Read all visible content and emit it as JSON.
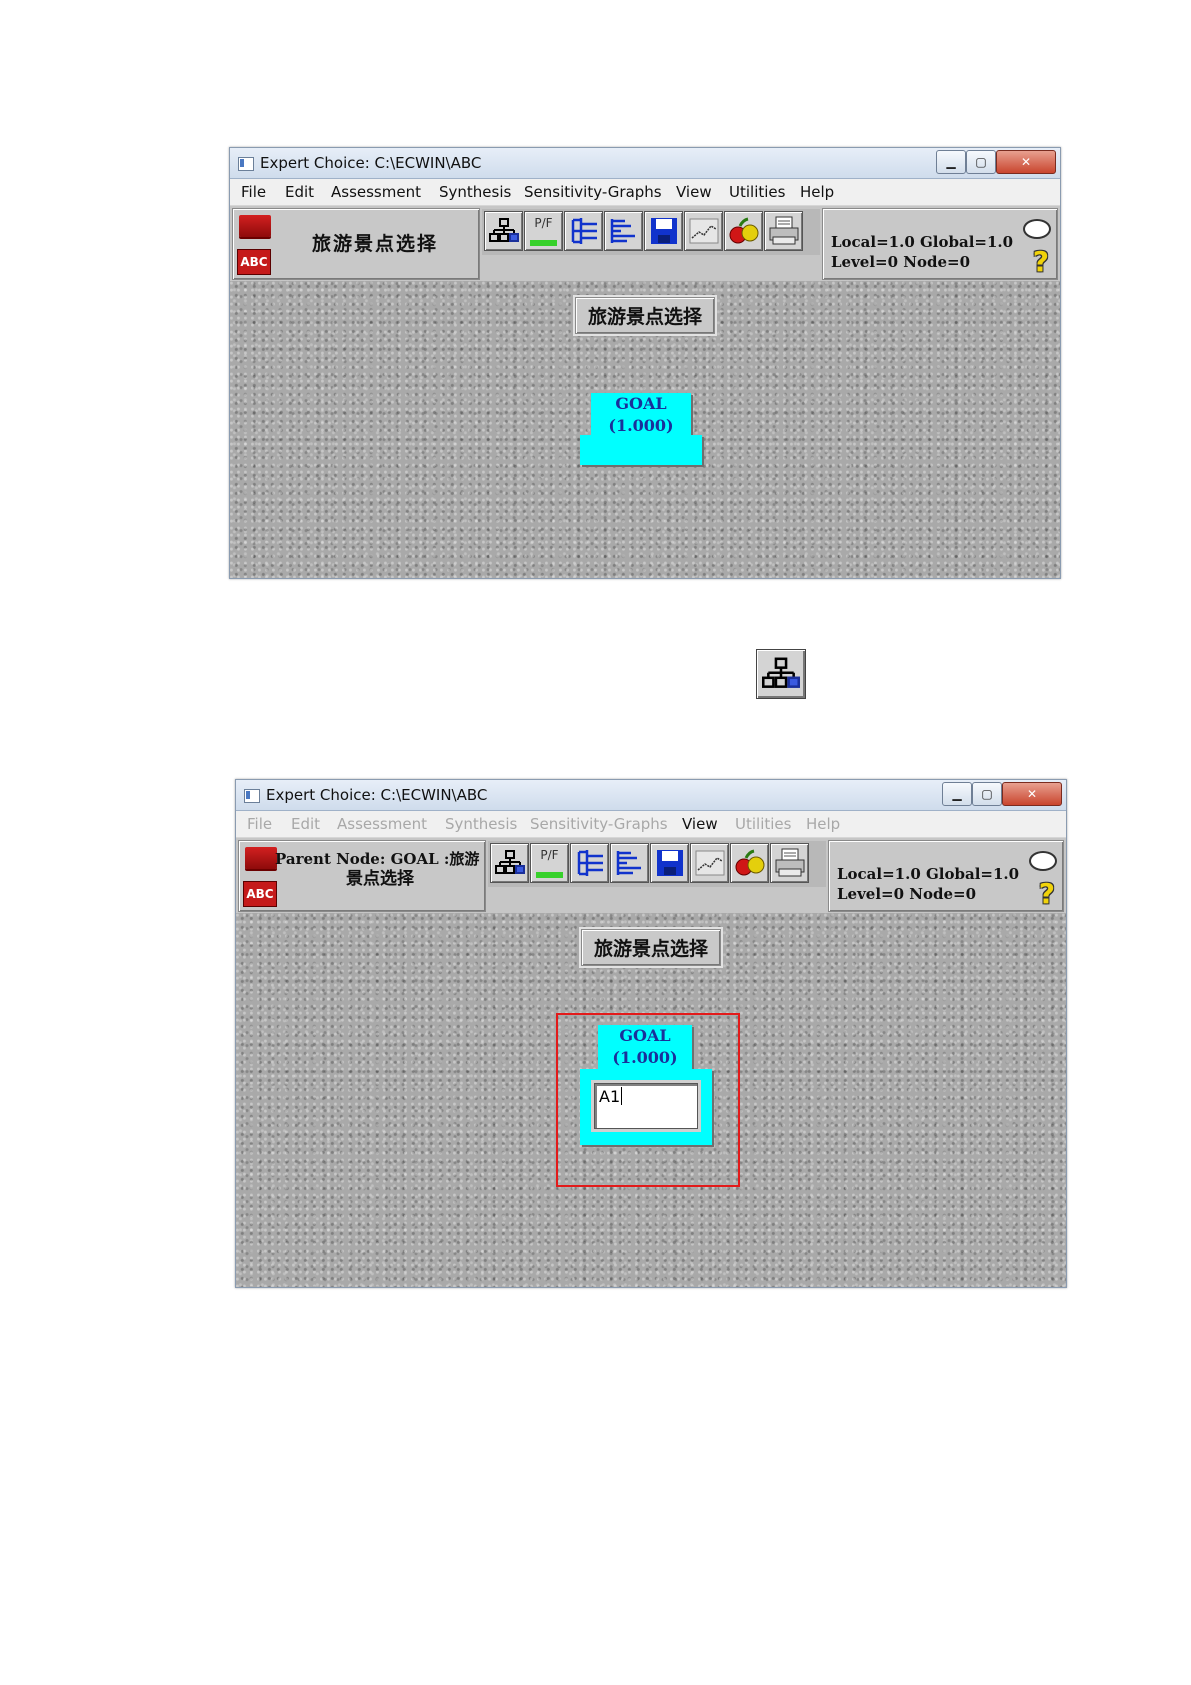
{
  "window_title": "Expert Choice: C:\\ECWIN\\ABC",
  "menu": [
    "File",
    "Edit",
    "Assessment",
    "Synthesis",
    "Sensitivity-Graphs",
    "View",
    "Utilities",
    "Help"
  ],
  "menu2_active": "View",
  "toolbar_labels": {
    "pf": "P/F",
    "abc": "ABC"
  },
  "goal_name": "旅游景点选择",
  "info": {
    "local_global": "Local=1.0 Global=1.0",
    "level_node": "Level=0  Node=0"
  },
  "node": {
    "label": "GOAL",
    "value": "(1.000)"
  },
  "win2": {
    "parent_node_line1": "Parent Node:  GOAL :旅游",
    "parent_node_line2": "景点选择",
    "edit_value": "A1"
  },
  "colors": {
    "node_fill": "#00ffff",
    "node_text": "#1a2f9a",
    "highlight": "#e31a1a",
    "pf_bar": "#37d12b"
  },
  "icons": [
    "hierarchy-icon",
    "pf-icon",
    "tree-expand-icon",
    "bar-list-icon",
    "save-disk-icon",
    "line-graph-icon",
    "apples-icon",
    "printer-icon",
    "speech-bubble-icon",
    "question-icon",
    "book-icon"
  ]
}
